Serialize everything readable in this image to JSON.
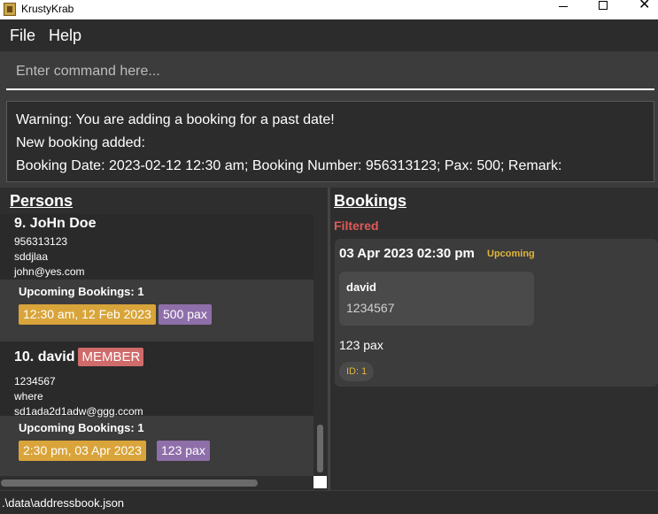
{
  "window": {
    "title": "KrustyKrab",
    "min_glyph": "",
    "max_glyph": "",
    "close_glyph": "✕"
  },
  "menu": {
    "file": "File",
    "help": "Help"
  },
  "command": {
    "placeholder": "Enter command here..."
  },
  "result": {
    "lines": [
      "Warning: You are adding a booking for a past date!",
      "New booking added:",
      "Booking Date: 2023-02-12 12:30 am; Booking Number: 956313123; Pax: 500; Remark:"
    ]
  },
  "persons": {
    "header": "Persons",
    "items": [
      {
        "name": "9. JoHn Doe",
        "tag": "",
        "phone": "956313123",
        "address": "sddjlaa",
        "email": "john@yes.com",
        "upcoming_label": "Upcoming Bookings:  1",
        "booking_time": "12:30 am, 12 Feb 2023",
        "booking_pax": "500 pax"
      },
      {
        "name": "10. david",
        "tag": "MEMBER",
        "phone": "1234567",
        "address": "where",
        "email": "sd1ada2d1adw@ggg.ccom",
        "upcoming_label": "Upcoming Bookings:  1",
        "booking_time": "2:30 pm, 03 Apr 2023",
        "booking_pax": "123 pax"
      }
    ]
  },
  "bookings": {
    "header": "Bookings",
    "filter_label": "Filtered",
    "items": [
      {
        "date": "03 Apr 2023 02:30 pm",
        "status": "Upcoming",
        "person_name": "david",
        "person_phone": "1234567",
        "pax": "123 pax",
        "id": "ID: 1"
      }
    ]
  },
  "status": {
    "path": ".\\data\\addressbook.json"
  },
  "colors": {
    "background": "#3c3c3c",
    "panel": "#2e2e2e",
    "time_chip": "#d9a43a",
    "pax_chip": "#8f6faa",
    "member_tag": "#d06b6b",
    "filtered": "#e05a5a",
    "upcoming": "#e0b53a"
  }
}
